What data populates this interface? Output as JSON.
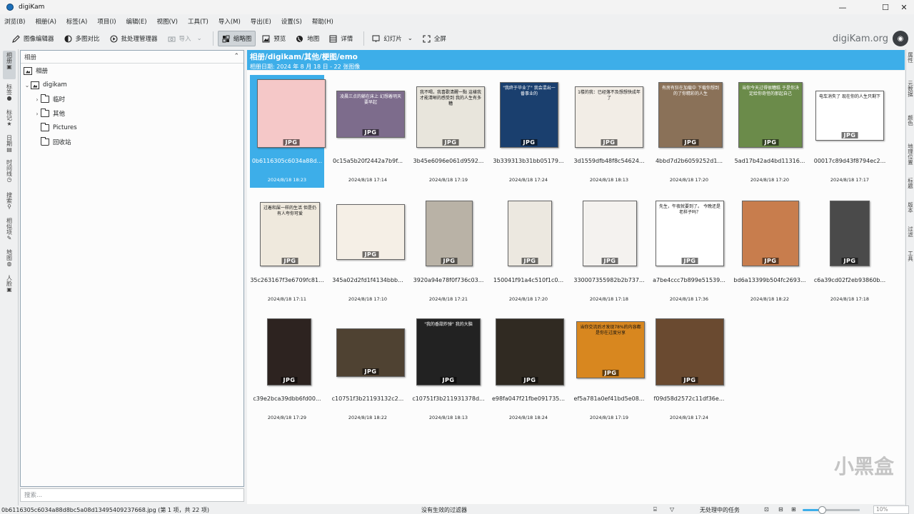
{
  "window": {
    "title": "digiKam",
    "controls": [
      "—",
      "☐",
      "✕"
    ]
  },
  "menu": [
    "浏览(B)",
    "相册(A)",
    "标签(A)",
    "项目(I)",
    "编辑(E)",
    "视图(V)",
    "工具(T)",
    "导入(M)",
    "导出(E)",
    "设置(S)",
    "帮助(H)"
  ],
  "toolbar": {
    "image_editor": "图像编辑器",
    "light_table": "多图对比",
    "batch_queue": "批处理管理器",
    "import": "导入",
    "thumbnails": "缩略图",
    "preview": "预览",
    "map": "地图",
    "details": "详情",
    "slideshow": "幻灯片",
    "fullscreen": "全屏"
  },
  "brand": {
    "text": "digiKam.org"
  },
  "left_tabs": [
    "相册",
    "标签",
    "标记",
    "日期",
    "时间线",
    "搜索",
    "相似项",
    "地图",
    "人脸"
  ],
  "right_tabs": [
    "属性",
    "元数据",
    "颜色",
    "地理位置",
    "标题",
    "版本",
    "过滤",
    "工具"
  ],
  "album_panel": {
    "header": "相册",
    "tree": [
      {
        "label": "相册",
        "kind": "root"
      },
      {
        "label": "digikam",
        "kind": "album"
      },
      {
        "label": "临时",
        "kind": "folder"
      },
      {
        "label": "其他",
        "kind": "folder"
      },
      {
        "label": "Pictures",
        "kind": "folder"
      },
      {
        "label": "回收站",
        "kind": "trash"
      }
    ],
    "search_placeholder": "搜索..."
  },
  "album_header": {
    "title": "相册/digikam/其他/梗图/emo",
    "subtitle": "相册日期: 2024 年 8 月 18 日 - 22 张图像"
  },
  "items": [
    {
      "name": "0b6116305c6034a88d...",
      "date": "2024/8/18 18:23",
      "badge": "JPG",
      "selected": true,
      "caption": ""
    },
    {
      "name": "0c15a5b20f2442a7b9f...",
      "date": "2024/8/18 17:14",
      "badge": "JPG",
      "caption": "凌晨三点的躺在床上 幻想着明天要早起"
    },
    {
      "name": "3b45e6096e061d9592...",
      "date": "2024/8/18 17:19",
      "badge": "JPG",
      "caption": "我不喝，我喜歡清醒一點 這樣我才能清晰的感受到 我的人生有多糟"
    },
    {
      "name": "3b339313b31bb05179...",
      "date": "2024/8/18 17:24",
      "badge": "JPG",
      "caption": "\"我终于毕业了\" 我会混出一番事业的"
    },
    {
      "name": "3d1559dfb48f8c54624...",
      "date": "2024/8/18 18:13",
      "badge": "JPG",
      "caption": "1楼的我：已经落不及想想快成年了"
    },
    {
      "name": "4bbd7d2b6059252d1...",
      "date": "2024/8/18 17:20",
      "badge": "JPG",
      "caption": "有房有狂在加载中 下载你想到的了你精彩的人生"
    },
    {
      "name": "5ad17b42ad4bd11316...",
      "date": "2024/8/18 17:20",
      "badge": "JPG",
      "caption": "当你今天过得很糟糕 于是你决定给你奇怪的那起自己"
    },
    {
      "name": "00017c89d43f8794ec2...",
      "date": "2024/8/18 17:17",
      "badge": "JPG",
      "caption": "电车消失了 现在你的人生只剩下"
    },
    {
      "name": "35c263167f3e6709fc81...",
      "date": "2024/8/18 17:11",
      "badge": "JPG",
      "caption": "过着和屎一样的生活 但是仍有人夸你可爱"
    },
    {
      "name": "345a02d2fd1f4134bbb...",
      "date": "2024/8/18 17:10",
      "badge": "JPG",
      "caption": ""
    },
    {
      "name": "3920a94e78f0f736c03...",
      "date": "2024/8/18 17:21",
      "badge": "JPG",
      "caption": ""
    },
    {
      "name": "150041f91a4c510f1c0...",
      "date": "2024/8/18 17:20",
      "badge": "JPG",
      "caption": ""
    },
    {
      "name": "330007355982b2b737...",
      "date": "2024/8/18 17:18",
      "badge": "JPG",
      "caption": ""
    },
    {
      "name": "a7be4ccc7b899e51539...",
      "date": "2024/8/18 17:36",
      "badge": "JPG",
      "caption": "先生，午夜就要到了。 今晚还是老样子吗？"
    },
    {
      "name": "bd6a13399b504fc2693...",
      "date": "2024/8/18 18:22",
      "badge": "JPG",
      "caption": ""
    },
    {
      "name": "c6a39cd02f2eb93860b...",
      "date": "2024/8/18 17:18",
      "badge": "JPG",
      "caption": ""
    },
    {
      "name": "c39e2bca39dbb6fd00...",
      "date": "2024/8/18 17:29",
      "badge": "JPG",
      "caption": ""
    },
    {
      "name": "c10751f3b21193132c2...",
      "date": "2024/8/18 18:22",
      "badge": "JPG",
      "caption": ""
    },
    {
      "name": "c10751f3b211931378d...",
      "date": "2024/8/18 18:13",
      "badge": "JPG",
      "caption": "\"我的香甜炸弹\" 我的大脑"
    },
    {
      "name": "e98fa047f21fbe091735...",
      "date": "2024/8/18 18:24",
      "badge": "JPG",
      "caption": ""
    },
    {
      "name": "ef5a781a0ef41bd5e08...",
      "date": "2024/8/18 17:19",
      "badge": "JPG",
      "caption": "当你交流后才发现78%的内容都是你在过度分享"
    },
    {
      "name": "f09d58d2572c11df36e...",
      "date": "2024/8/18 17:24",
      "badge": "JPG",
      "caption": ""
    }
  ],
  "status": {
    "file": "0b6116305c6034a88d8bc5a08d13495409237668.jpg (第 1 项，共 22 项)",
    "filter": "没有生效的过滤器",
    "tasks": "无处理中的任务",
    "zoom": "10%"
  },
  "watermark": "小黑盒",
  "colors": {
    "accent": "#3daee9",
    "window_bg": "#eff0f1",
    "view_bg": "#fcfcfc"
  }
}
